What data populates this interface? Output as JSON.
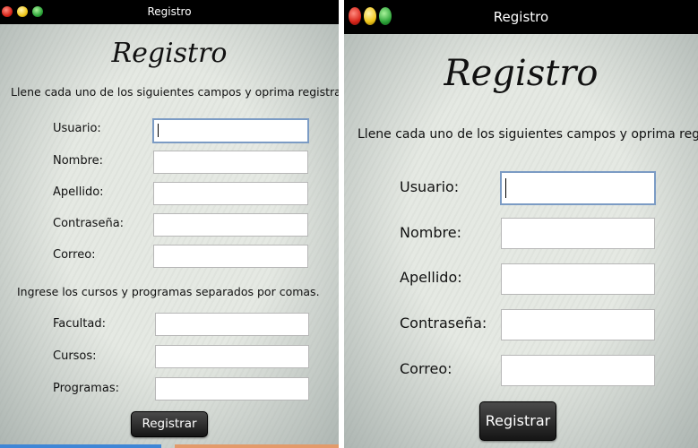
{
  "left_window": {
    "title": "Registro",
    "heading": "Registro",
    "instruction": "Llene cada uno de los siguientes campos y oprima registrar.",
    "fields": [
      {
        "label": "Usuario:",
        "value": ""
      },
      {
        "label": "Nombre:",
        "value": ""
      },
      {
        "label": "Apellido:",
        "value": ""
      },
      {
        "label": "Contraseña:",
        "value": ""
      },
      {
        "label": "Correo:",
        "value": ""
      }
    ],
    "secondary_instruction": "Ingrese los cursos y programas separados por comas.",
    "extra_fields": [
      {
        "label": "Facultad:",
        "value": ""
      },
      {
        "label": "Cursos:",
        "value": ""
      },
      {
        "label": "Programas:",
        "value": ""
      }
    ],
    "submit_label": "Registrar"
  },
  "right_window": {
    "title": "Registro",
    "heading": "Registro",
    "instruction": "Llene cada uno de los siguientes campos y oprima registrar.",
    "fields": [
      {
        "label": "Usuario:",
        "value": ""
      },
      {
        "label": "Nombre:",
        "value": ""
      },
      {
        "label": "Apellido:",
        "value": ""
      },
      {
        "label": "Contraseña:",
        "value": ""
      },
      {
        "label": "Correo:",
        "value": ""
      }
    ],
    "submit_label": "Registrar"
  },
  "colors": {
    "titlebar": "#000000",
    "focus_border": "#7b9bc4",
    "button": "#2a2a2a",
    "bottom_strip_blue": "#3f86d6",
    "bottom_strip_orange": "#e39a6a"
  }
}
